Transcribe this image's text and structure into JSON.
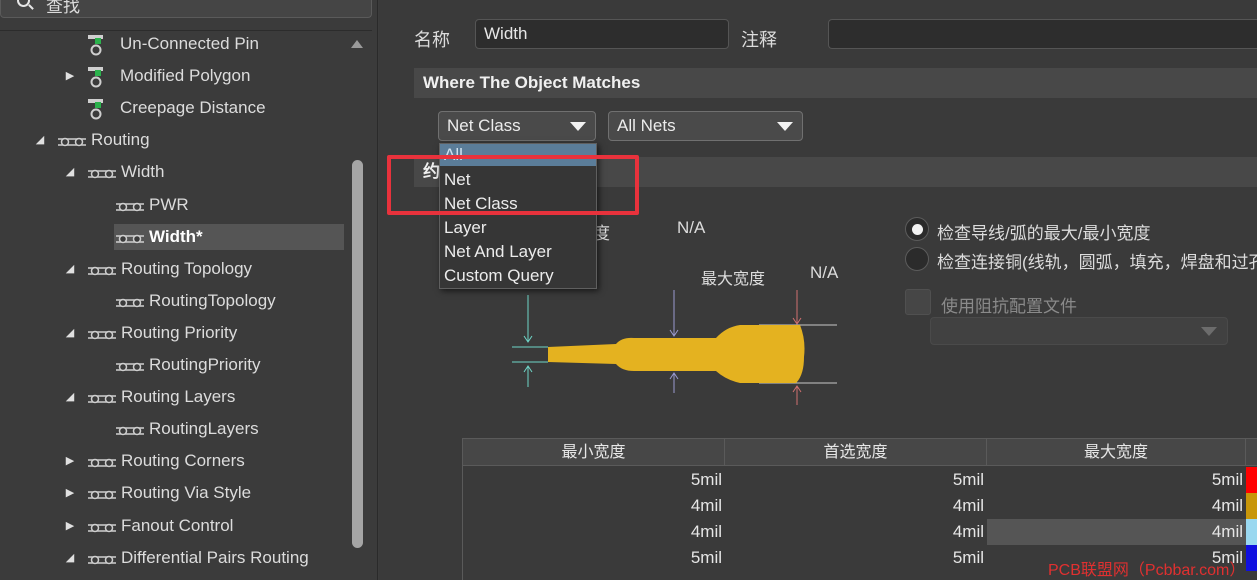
{
  "search": {
    "label": "查找"
  },
  "tree": [
    {
      "label": "Un-Connected Pin",
      "level": 2,
      "arrow": "",
      "icon": "rule"
    },
    {
      "label": "Modified Polygon",
      "level": 2,
      "arrow": "collapsed",
      "icon": "rule"
    },
    {
      "label": "Creepage Distance",
      "level": 2,
      "arrow": "",
      "icon": "rule"
    },
    {
      "label": "Routing",
      "level": 1,
      "arrow": "expanded",
      "icon": "route"
    },
    {
      "label": "Width",
      "level": 2,
      "arrow": "expanded",
      "icon": "route"
    },
    {
      "label": "PWR",
      "level": 3,
      "arrow": "",
      "icon": "route"
    },
    {
      "label": "Width*",
      "level": 3,
      "arrow": "",
      "icon": "route",
      "selected": true
    },
    {
      "label": "Routing Topology",
      "level": 2,
      "arrow": "expanded",
      "icon": "route"
    },
    {
      "label": "RoutingTopology",
      "level": 3,
      "arrow": "",
      "icon": "route"
    },
    {
      "label": "Routing Priority",
      "level": 2,
      "arrow": "expanded",
      "icon": "route"
    },
    {
      "label": "RoutingPriority",
      "level": 3,
      "arrow": "",
      "icon": "route"
    },
    {
      "label": "Routing Layers",
      "level": 2,
      "arrow": "expanded",
      "icon": "route"
    },
    {
      "label": "RoutingLayers",
      "level": 3,
      "arrow": "",
      "icon": "route"
    },
    {
      "label": "Routing Corners",
      "level": 2,
      "arrow": "collapsed",
      "icon": "route"
    },
    {
      "label": "Routing Via Style",
      "level": 2,
      "arrow": "collapsed",
      "icon": "route"
    },
    {
      "label": "Fanout Control",
      "level": 2,
      "arrow": "collapsed",
      "icon": "route"
    },
    {
      "label": "Differential Pairs Routing",
      "level": 2,
      "arrow": "expanded",
      "icon": "route"
    }
  ],
  "form": {
    "name_label": "名称",
    "name_value": "Width",
    "comment_label": "注释",
    "comment_value": ""
  },
  "where_section": {
    "title": "Where The Object Matches"
  },
  "constraints_section": {
    "title_fragment": "约"
  },
  "combo1": {
    "value": "Net Class"
  },
  "combo2": {
    "value": "All Nets"
  },
  "dropdown_options": [
    "All",
    "Net",
    "Net Class",
    "Layer",
    "Net And Layer",
    "Custom Query"
  ],
  "diagram": {
    "min_width_fragment": "度",
    "min_value": "N/A",
    "max_label": "最大宽度",
    "max_value": "N/A",
    "track_color": "#e4b220"
  },
  "options": {
    "radio1": "检查导线/弧的最大/最小宽度",
    "radio2": "检查连接铜(线轨，圆弧，填充，焊盘和过孔",
    "impedance_label": "使用阻抗配置文件"
  },
  "table": {
    "headers": [
      "最小宽度",
      "首选宽度",
      "最大宽度"
    ],
    "rows": [
      {
        "min": "5mil",
        "pref": "5mil",
        "max": "5mil",
        "color": "#ff0000"
      },
      {
        "min": "4mil",
        "pref": "4mil",
        "max": "4mil",
        "color": "#c8960a"
      },
      {
        "min": "4mil",
        "pref": "4mil",
        "max": "4mil",
        "color": "#9ad8f0"
      },
      {
        "min": "5mil",
        "pref": "5mil",
        "max": "5mil",
        "color": "#1010e0"
      }
    ]
  },
  "watermark": "PCB联盟网（Pcbbar.com）"
}
